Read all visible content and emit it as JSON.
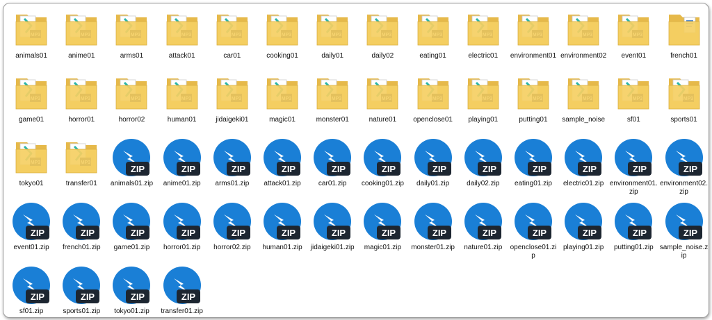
{
  "folders": [
    {
      "name": "animals01",
      "type": "mp3"
    },
    {
      "name": "anime01",
      "type": "mp3"
    },
    {
      "name": "arms01",
      "type": "mp3"
    },
    {
      "name": "attack01",
      "type": "mp3"
    },
    {
      "name": "car01",
      "type": "mp3"
    },
    {
      "name": "cooking01",
      "type": "mp3"
    },
    {
      "name": "daily01",
      "type": "mp3"
    },
    {
      "name": "daily02",
      "type": "mp3"
    },
    {
      "name": "eating01",
      "type": "mp3"
    },
    {
      "name": "electric01",
      "type": "mp3"
    },
    {
      "name": "environment01",
      "type": "mp3"
    },
    {
      "name": "environment02",
      "type": "mp3"
    },
    {
      "name": "event01",
      "type": "mp3"
    },
    {
      "name": "french01",
      "type": "doc"
    },
    {
      "name": "game01",
      "type": "mp3"
    },
    {
      "name": "horror01",
      "type": "mp3"
    },
    {
      "name": "horror02",
      "type": "mp3"
    },
    {
      "name": "human01",
      "type": "mp3"
    },
    {
      "name": "jidaigeki01",
      "type": "mp3"
    },
    {
      "name": "magic01",
      "type": "mp3"
    },
    {
      "name": "monster01",
      "type": "mp3"
    },
    {
      "name": "nature01",
      "type": "mp3"
    },
    {
      "name": "openclose01",
      "type": "mp3"
    },
    {
      "name": "playing01",
      "type": "mp3"
    },
    {
      "name": "putting01",
      "type": "mp3"
    },
    {
      "name": "sample_noise",
      "type": "mp3"
    },
    {
      "name": "sf01",
      "type": "mp3"
    },
    {
      "name": "sports01",
      "type": "mp3"
    },
    {
      "name": "tokyo01",
      "type": "mp3"
    },
    {
      "name": "transfer01",
      "type": "mp3"
    }
  ],
  "zips": [
    "animals01.zip",
    "anime01.zip",
    "arms01.zip",
    "attack01.zip",
    "car01.zip",
    "cooking01.zip",
    "daily01.zip",
    "daily02.zip",
    "eating01.zip",
    "electric01.zip",
    "environment01.zip",
    "environment02.zip",
    "event01.zip",
    "french01.zip",
    "game01.zip",
    "horror01.zip",
    "horror02.zip",
    "human01.zip",
    "jidaigeki01.zip",
    "magic01.zip",
    "monster01.zip",
    "nature01.zip",
    "openclose01.zip",
    "playing01.zip",
    "putting01.zip",
    "sample_noise.zip",
    "sf01.zip",
    "sports01.zip",
    "tokyo01.zip",
    "transfer01.zip"
  ],
  "icon_text": {
    "mp3": "MP3",
    "zip": "ZIP"
  },
  "colors": {
    "folder": "#f5cf63",
    "folder_back": "#e6b94a",
    "zip_blue": "#1a7fd6",
    "zip_dark": "#1d2631",
    "teal": "#2bb5a8"
  }
}
